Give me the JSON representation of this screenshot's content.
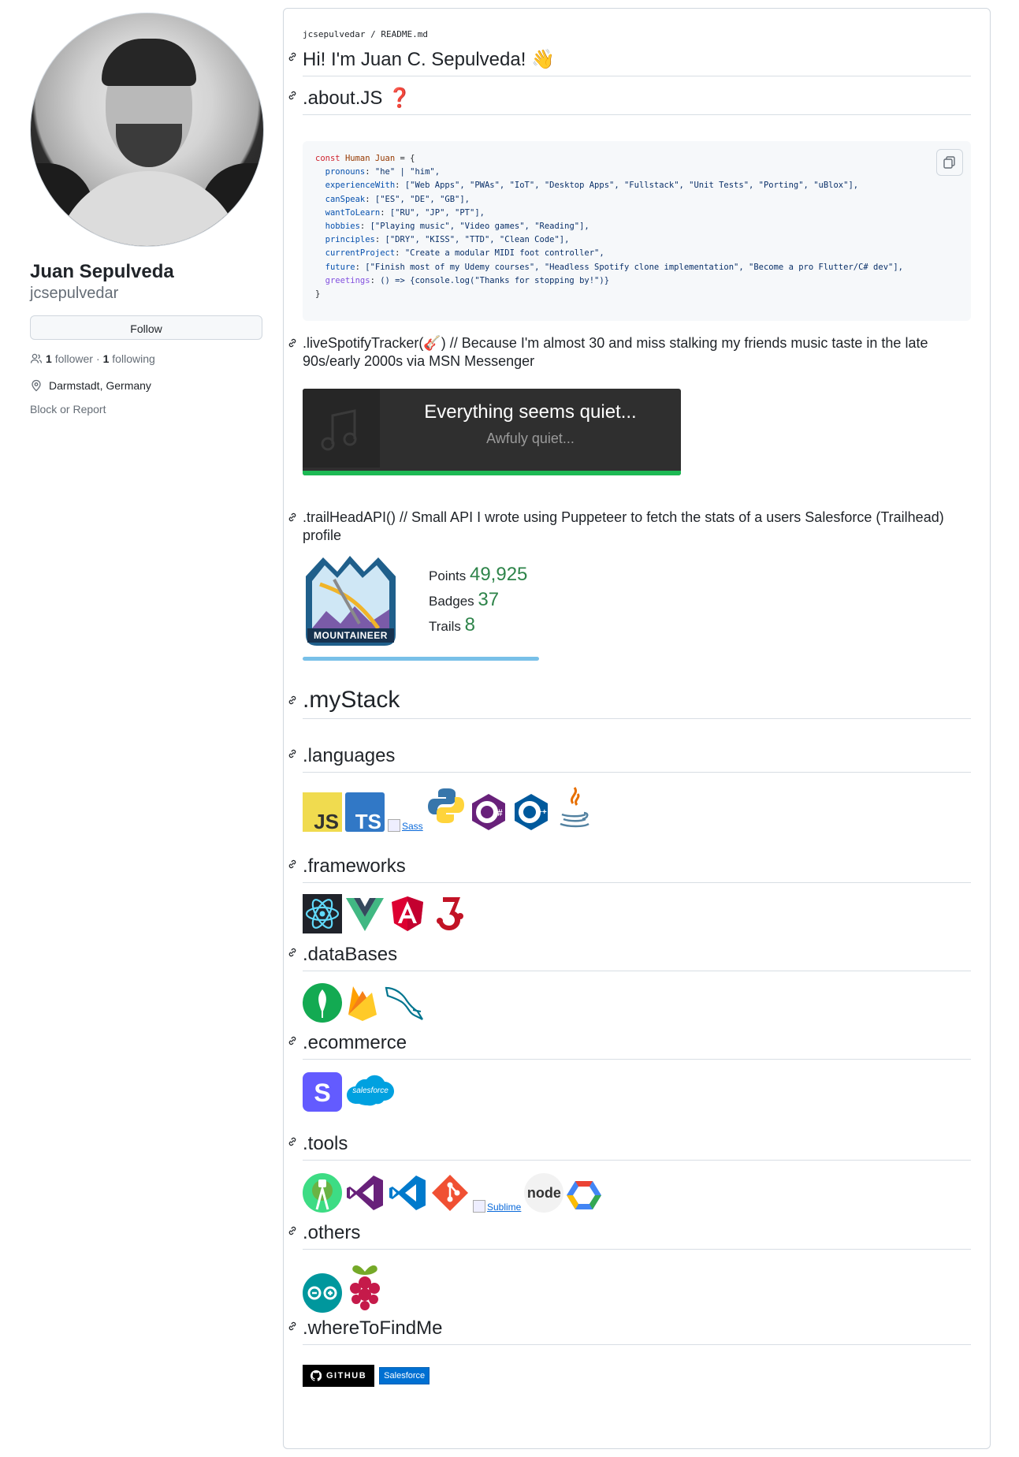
{
  "profile": {
    "fullname": "Juan Sepulveda",
    "login": "jcsepulvedar",
    "follow_label": "Follow",
    "followers_count": "1",
    "followers_label": "follower",
    "separator": "·",
    "following_count": "1",
    "following_label": "following",
    "location": "Darmstadt, Germany",
    "block_label": "Block or Report"
  },
  "readme": {
    "breadcrumb_user": "jcsepulvedar",
    "breadcrumb_sep": "/",
    "breadcrumb_file": "README.md",
    "greeting": "Hi! I'm Juan C. Sepulveda! 👋",
    "about": ".about.JS ❓",
    "code": {
      "l1_kw": "const",
      "l1_var": "Human Juan",
      "l1_rest": " = {",
      "lines": [
        {
          "prop": "pronouns",
          "val": "\"he\" | \"him\","
        },
        {
          "prop": "experienceWith",
          "val": "[\"Web Apps\", \"PWAs\", \"IoT\", \"Desktop Apps\", \"Fullstack\", \"Unit Tests\", \"Porting\", \"uBlox\"],"
        },
        {
          "prop": "canSpeak",
          "val": "[\"ES\", \"DE\", \"GB\"],"
        },
        {
          "prop": "wantToLearn",
          "val": "[\"RU\", \"JP\", \"PT\"],"
        },
        {
          "prop": "hobbies",
          "val": "[\"Playing music\", \"Video games\", \"Reading\"],"
        },
        {
          "prop": "principles",
          "val": "[\"DRY\", \"KISS\", \"TTD\", \"Clean Code\"],"
        },
        {
          "prop": "currentProject",
          "val": "\"Create a modular MIDI foot controller\","
        },
        {
          "prop": "future",
          "val": "[\"Finish most of my Udemy courses\", \"Headless Spotify clone implementation\", \"Become a pro Flutter/C# dev\"],"
        },
        {
          "prop": "greetings",
          "val": "() => {console.log(\"Thanks for stopping by!\")}"
        }
      ],
      "close": "}"
    },
    "spotify_heading": ".liveSpotifyTracker(🎸) // Because I'm almost 30 and miss stalking my friends music taste in the late 90s/early 2000s via MSN Messenger",
    "spotify_title": "Everything seems quiet...",
    "spotify_sub": "Awfuly quiet...",
    "trail_heading": ".trailHeadAPI() // Small API I wrote using Puppeteer to fetch the stats of a users Salesforce (Trailhead) profile",
    "trail_badge": "MOUNTAINEER",
    "points_label": "Points",
    "points_value": "49,925",
    "badges_label": "Badges",
    "badges_value": "37",
    "trails_label": "Trails",
    "trails_value": "8",
    "mystack": ".myStack",
    "languages": ".languages",
    "sass_alt": "Sass",
    "frameworks": ".frameworks",
    "databases": ".dataBases",
    "ecommerce": ".ecommerce",
    "salesforce_logo": "salesforce",
    "tools": ".tools",
    "sublime_alt": "Sublime",
    "node_text": "node",
    "others": ".others",
    "wheretofind": ".whereToFindMe",
    "github_badge": "GITHUB",
    "salesforce_badge": "Salesforce"
  },
  "colors": {
    "accent": "#0969da",
    "trail_green": "#2e844a",
    "spotify_green": "#1db954"
  }
}
